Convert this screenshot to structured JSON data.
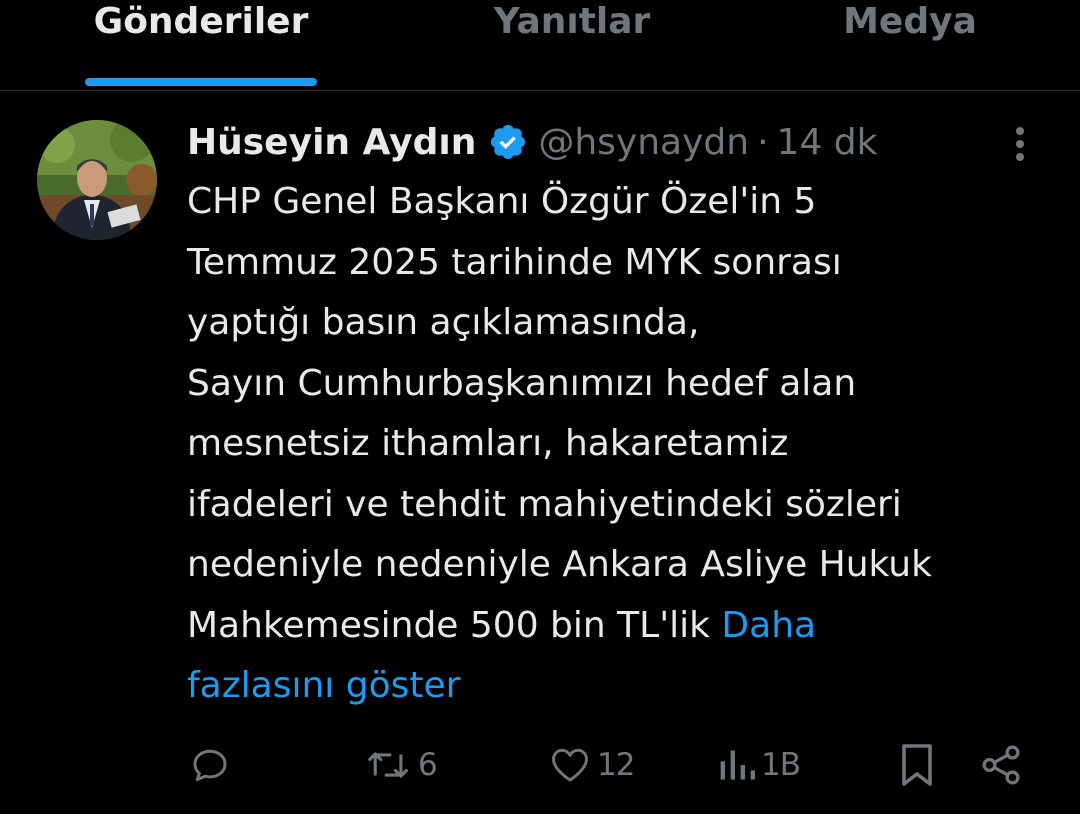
{
  "tabs": [
    {
      "label": "Gönderiler",
      "active": true
    },
    {
      "label": "Yanıtlar",
      "active": false
    },
    {
      "label": "Medya",
      "active": false
    }
  ],
  "post": {
    "author_name": "Hüseyin Aydın",
    "verified_icon": "verified-badge-icon",
    "handle": "@hsynaydn",
    "separator": "·",
    "time": "14 dk",
    "text": "CHP Genel Başkanı Özgür Özel'in 5\nTemmuz 2025 tarihinde MYK sonrası\nyaptığı basın açıklamasında,\nSayın Cumhurbaşkanımızı hedef alan\nmesnetsiz ithamları, hakaretamiz\nifadeleri ve tehdit mahiyetindeki sözleri\nnedeniyle nedeniyle Ankara Asliye Hukuk\nMahkemesinde 500 bin TL'lik ",
    "show_more": "Daha\nfazlasını göster"
  },
  "actions": {
    "reply_count": "",
    "repost_count": "6",
    "like_count": "12",
    "views_count": "1B"
  },
  "colors": {
    "background": "#000000",
    "text_primary": "#e7e9ea",
    "text_secondary": "#71767b",
    "accent": "#1d9bf0"
  }
}
